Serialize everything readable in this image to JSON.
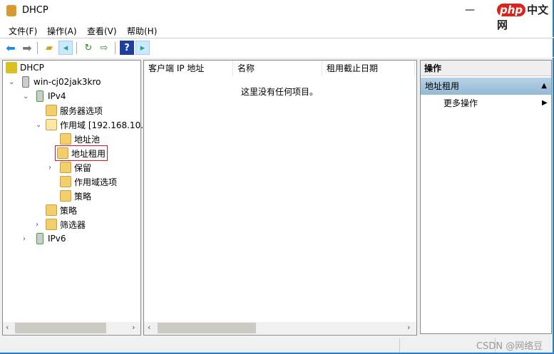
{
  "window": {
    "title": "DHCP",
    "watermark_brand": "php",
    "watermark_text": "中文网"
  },
  "menu": [
    "文件(F)",
    "操作(A)",
    "查看(V)",
    "帮助(H)"
  ],
  "toolbar": [
    {
      "icon": "back-arrow"
    },
    {
      "icon": "forward-arrow"
    },
    {
      "icon": "up-folder"
    },
    {
      "icon": "show-hide-console-tree"
    },
    {
      "icon": "refresh"
    },
    {
      "icon": "export-list"
    },
    {
      "icon": "help"
    },
    {
      "icon": "show-hide-action-pane"
    }
  ],
  "tree": [
    {
      "label": "DHCP"
    },
    {
      "label": "win-cj02jak3kro"
    },
    {
      "label": "IPv4"
    },
    {
      "label": "服务器选项"
    },
    {
      "label": "作用域 [192.168.10."
    },
    {
      "label": "地址池"
    },
    {
      "label": "地址租用",
      "selected": true
    },
    {
      "label": "保留"
    },
    {
      "label": "作用域选项"
    },
    {
      "label": "策略"
    },
    {
      "label": "策略"
    },
    {
      "label": "筛选器"
    },
    {
      "label": "IPv6"
    }
  ],
  "list": {
    "columns": [
      "客户端 IP 地址",
      "名称",
      "租用截止日期"
    ],
    "empty_text": "这里没有任何项目。"
  },
  "actions": {
    "header": "操作",
    "section": "地址租用",
    "more": "更多操作"
  },
  "status": {
    "credit": "CSDN @网络豆"
  }
}
